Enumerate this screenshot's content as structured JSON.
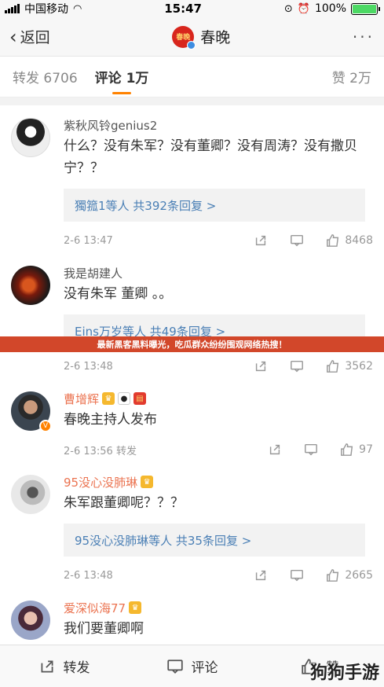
{
  "status_bar": {
    "carrier": "中国移动",
    "time": "15:47",
    "battery_percent": "100%",
    "battery_level": 1.0
  },
  "nav": {
    "back_label": "返回",
    "title": "春晚",
    "avatar_text": "春晚",
    "more": "···"
  },
  "tabs": {
    "reposts": "转发 6706",
    "comments": "评论 1万",
    "likes": "赞 2万"
  },
  "banner": "最新黑客黑料曝光，吃瓜群众纷纷围观网络热搜！",
  "comments": [
    {
      "name": "紫秋风铃genius2",
      "text": "什么？没有朱军？没有董卿？没有周涛？没有撒贝宁？？",
      "replies": "獨箛1等人  共392条回复 >",
      "time": "2-6 13:47",
      "likes": "8468"
    },
    {
      "name": "我是胡建人",
      "text": "没有朱军 董卿 。。",
      "replies": "Eins万岁等人  共49条回复 >",
      "time": "2-6 13:48",
      "likes": "3562"
    },
    {
      "name": "曹增辉",
      "text": "春晚主持人发布",
      "time": "2-6 13:56 转发",
      "likes": "97"
    },
    {
      "name": "95没心没肺琳",
      "text": "朱军跟董卿呢？？？",
      "replies": "95没心没肺琳等人  共35条回复 >",
      "time": "2-6 13:48",
      "likes": "2665"
    },
    {
      "name": "爱深似海77",
      "text": "我们要董卿啊"
    }
  ],
  "bottom_bar": {
    "repost": "转发",
    "comment": "评论",
    "like": "赞"
  },
  "watermark": "狗狗手游"
}
